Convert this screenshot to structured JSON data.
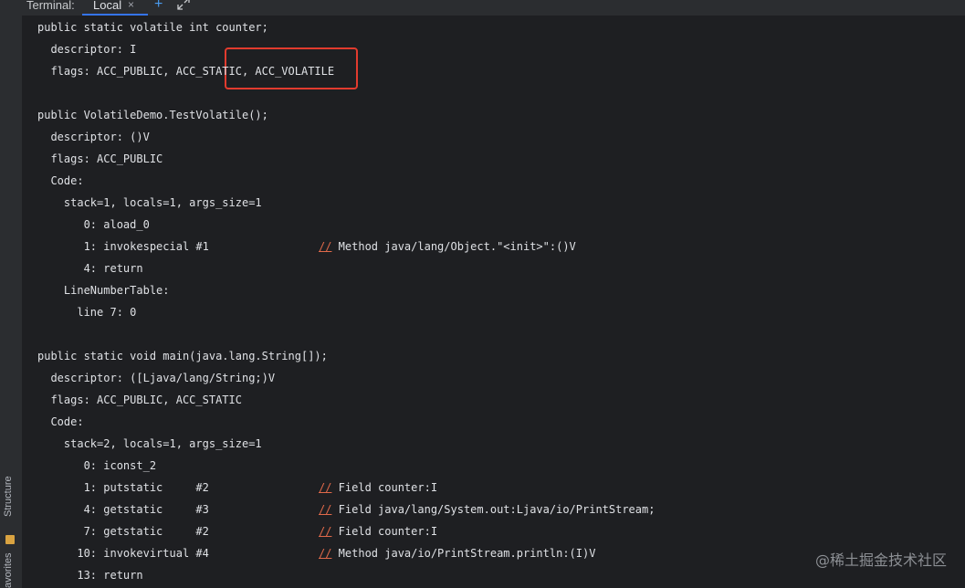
{
  "toolbar": {
    "terminal_label": "Terminal:",
    "tab_label": "Local",
    "close_glyph": "×",
    "new_tab_glyph": "+"
  },
  "side_panel": {
    "structure_label": "Structure",
    "favorites_label": "avorites"
  },
  "terminal": {
    "lines": [
      {
        "text": "public static volatile int counter;"
      },
      {
        "text": "  descriptor: I"
      },
      {
        "text": "  flags: ACC_PUBLIC, ACC_STATIC, ACC_VOLATILE"
      },
      {
        "text": ""
      },
      {
        "text": "public VolatileDemo.TestVolatile();"
      },
      {
        "text": "  descriptor: ()V"
      },
      {
        "text": "  flags: ACC_PUBLIC"
      },
      {
        "text": "  Code:"
      },
      {
        "text": "    stack=1, locals=1, args_size=1"
      },
      {
        "text": "       0: aload_0"
      },
      {
        "text": "       1: invokespecial #1",
        "comment": " Method java/lang/Object.\"<init>\":()V"
      },
      {
        "text": "       4: return"
      },
      {
        "text": "    LineNumberTable:"
      },
      {
        "text": "      line 7: 0"
      },
      {
        "text": ""
      },
      {
        "text": "public static void main(java.lang.String[]);"
      },
      {
        "text": "  descriptor: ([Ljava/lang/String;)V"
      },
      {
        "text": "  flags: ACC_PUBLIC, ACC_STATIC"
      },
      {
        "text": "  Code:"
      },
      {
        "text": "    stack=2, locals=1, args_size=1"
      },
      {
        "text": "       0: iconst_2"
      },
      {
        "text": "       1: putstatic     #2",
        "comment": " Field counter:I"
      },
      {
        "text": "       4: getstatic     #3",
        "comment": " Field java/lang/System.out:Ljava/io/PrintStream;"
      },
      {
        "text": "       7: getstatic     #2",
        "comment": " Field counter:I"
      },
      {
        "text": "      10: invokevirtual #4",
        "comment": " Method java/io/PrintStream.println:(I)V"
      },
      {
        "text": "      13: return"
      }
    ],
    "comment_marker": "//"
  },
  "watermark": "@稀土掘金技术社区",
  "colors": {
    "background": "#1e1f22",
    "text": "#dfe1e5",
    "comment_marker": "#e0694a",
    "highlight_box": "#e23b2e",
    "tab_underline": "#3574f0"
  }
}
